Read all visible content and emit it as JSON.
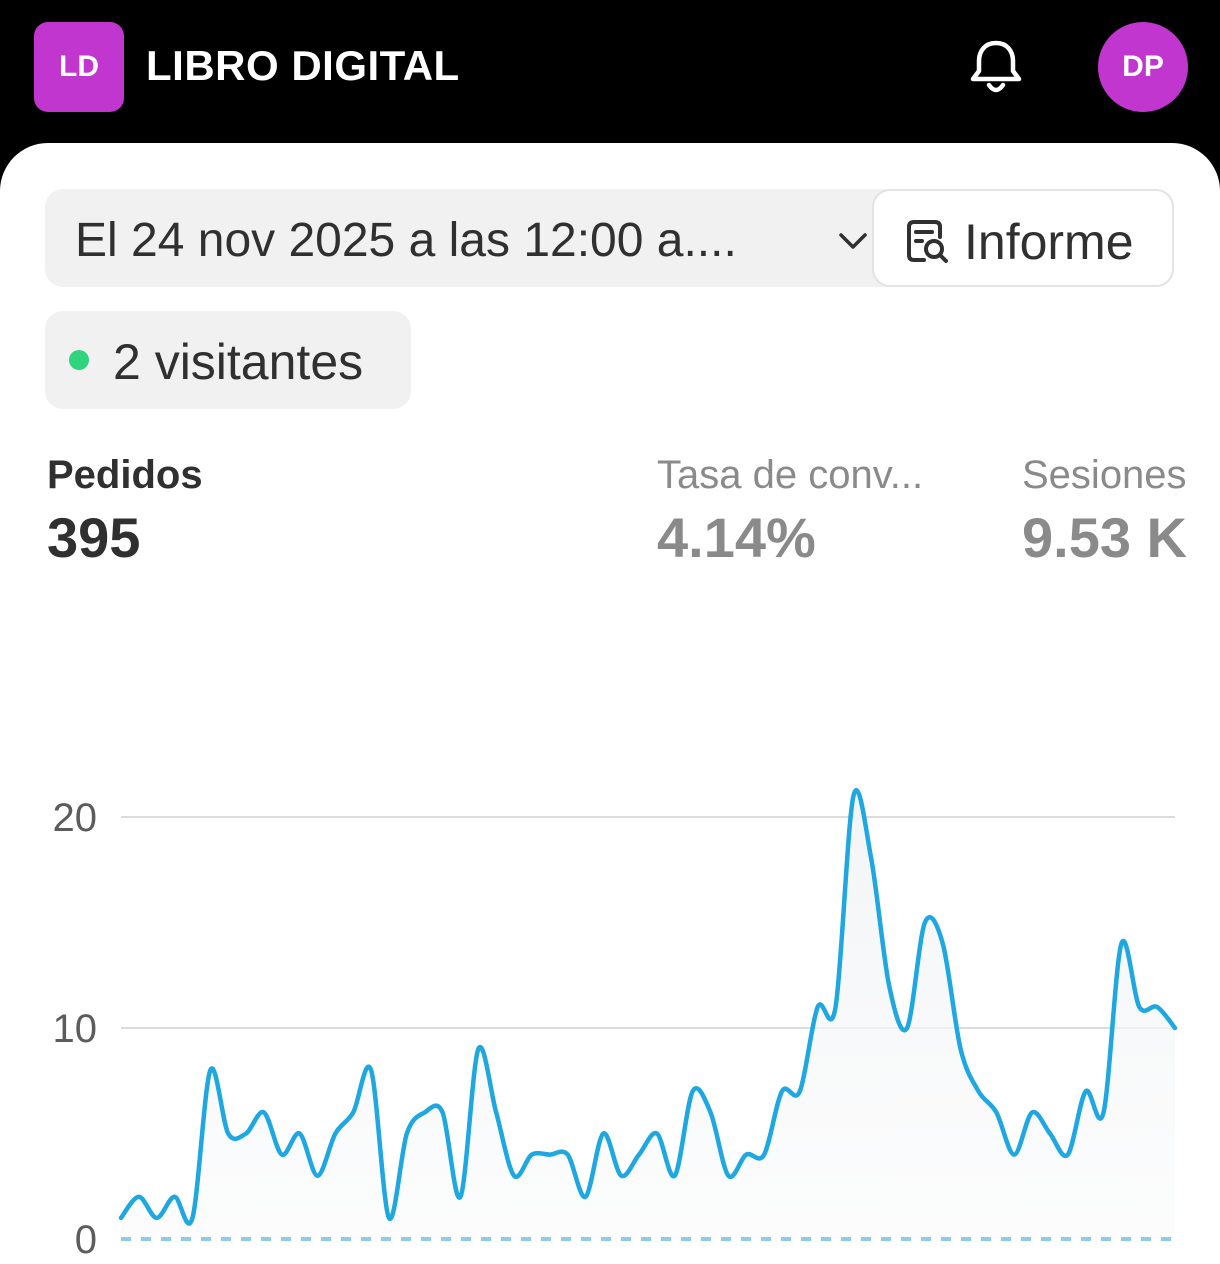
{
  "header": {
    "store_initials": "LD",
    "store_name": "LIBRO DIGITAL",
    "notification_icon": "bell-icon",
    "user_initials": "DP",
    "accent_color": "#c236d0"
  },
  "filters": {
    "date_range": "El 24 nov 2025 a las 12:00 a....",
    "report_label": "Informe",
    "report_icon": "report-search-icon"
  },
  "live": {
    "visitors_text": "2 visitantes",
    "status_color": "#2fd47e"
  },
  "metrics": [
    {
      "label": "Pedidos",
      "value": "395",
      "active": true
    },
    {
      "label": "Tasa de conv...",
      "value": "4.14%",
      "active": false
    },
    {
      "label": "Sesiones",
      "value": "9.53 K",
      "active": false
    }
  ],
  "chart_data": {
    "type": "line",
    "ylim": [
      0,
      20
    ],
    "yticks": [
      "0",
      "10",
      "20"
    ],
    "line_color": "#1ea7e0",
    "grid": true,
    "series": [
      {
        "values": [
          1,
          2,
          1,
          2,
          1,
          8,
          5,
          5,
          6,
          4,
          5,
          3,
          5,
          6,
          8,
          1,
          5,
          6,
          6,
          2,
          9,
          6,
          3,
          4,
          4,
          4,
          2,
          5,
          3,
          4,
          5,
          3,
          7,
          6,
          3,
          4,
          4,
          7,
          7,
          11,
          11,
          21,
          18,
          12,
          10,
          15,
          14,
          9,
          7,
          6,
          4,
          6,
          5,
          4,
          7,
          6,
          14,
          11,
          11,
          10
        ]
      },
      {
        "values": [
          0,
          0,
          0,
          0,
          0,
          0,
          0,
          0,
          0,
          0,
          0,
          0,
          0,
          0,
          0,
          0,
          0,
          0,
          0,
          0,
          0,
          0,
          0,
          0,
          0,
          0,
          0,
          0,
          0,
          0,
          0,
          0,
          0,
          0,
          0,
          0,
          0,
          0,
          0,
          0,
          0,
          0,
          0,
          0,
          0,
          0,
          0,
          0,
          0,
          0,
          0,
          0,
          0,
          0,
          0,
          0,
          0,
          0,
          0,
          0
        ],
        "dashed": true,
        "color": "#8fcbe6"
      }
    ]
  }
}
